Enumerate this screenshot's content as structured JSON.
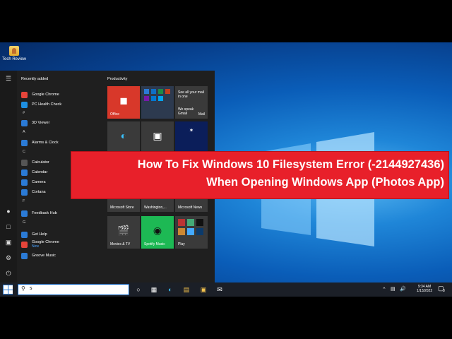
{
  "desktop": {
    "icon_label": "Tech Review"
  },
  "start_menu": {
    "recently_added_header": "Recently added",
    "tiles_header": "Productivity",
    "apps": [
      {
        "label": "Google Chrome",
        "icon": "chrome-icon",
        "color": "#e6453a"
      },
      {
        "label": "PC Health Check",
        "icon": "heart-icon",
        "color": "#1e8fe1"
      },
      {
        "letter": "#"
      },
      {
        "label": "3D Viewer",
        "icon": "cube-icon",
        "color": "#2b7bd6"
      },
      {
        "letter": "A"
      },
      {
        "label": "Alarms & Clock",
        "icon": "clock-icon",
        "color": "#2b7bd6"
      },
      {
        "letter": "C"
      },
      {
        "label": "Calculator",
        "icon": "calculator-icon",
        "color": "#555555"
      },
      {
        "label": "Calendar",
        "icon": "calendar-icon",
        "color": "#2b7bd6"
      },
      {
        "label": "Camera",
        "icon": "camera-icon",
        "color": "#2b7bd6"
      },
      {
        "label": "Cortana",
        "icon": "cortana-icon",
        "color": "#2b7bd6"
      },
      {
        "letter": "F"
      },
      {
        "label": "Feedback Hub",
        "icon": "feedback-icon",
        "color": "#2b7bd6"
      },
      {
        "letter": "G"
      },
      {
        "label": "Get Help",
        "icon": "help-icon",
        "color": "#2b7bd6"
      },
      {
        "label": "Google Chrome",
        "sublabel": "New",
        "icon": "chrome-icon",
        "color": "#e6453a"
      },
      {
        "label": "Groove Music",
        "icon": "music-icon",
        "color": "#2b7bd6"
      }
    ],
    "tiles": {
      "office": "Office",
      "mail_text1": "See all your mail in one",
      "mail_text2": "We speak Gmail",
      "mail_label": "Mail",
      "store": "Microsoft Store",
      "weather": "Washington,...",
      "news": "Microsoft News",
      "movies": "Movies & TV",
      "spotify": "Spotify Music",
      "play": "Play"
    }
  },
  "banner": {
    "line1": "How To Fix Windows 10 Filesystem Error (-2144927436)",
    "line2": "When Opening Windows App (Photos App)"
  },
  "taskbar": {
    "search_value": "s",
    "time": "9:34 AM",
    "date": "1/13/2022",
    "notification_count": "3"
  }
}
